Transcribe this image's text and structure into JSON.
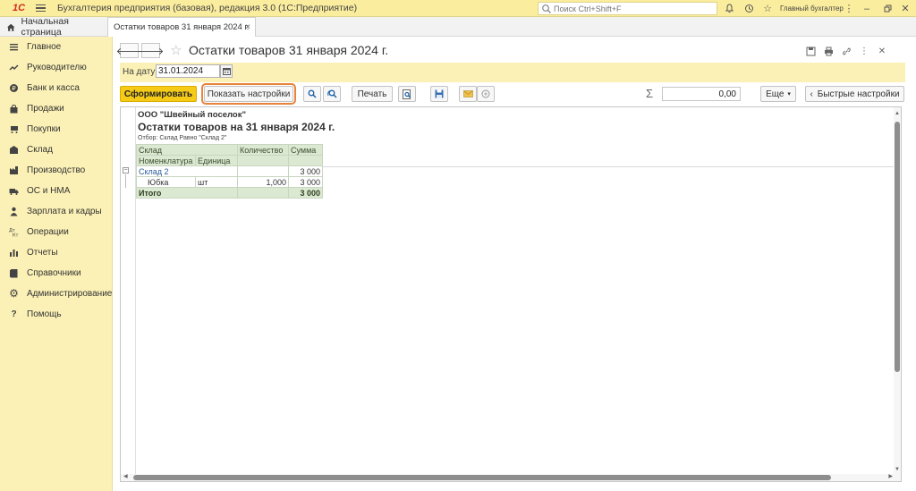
{
  "app": {
    "title": "Бухгалтерия предприятия (базовая), редакция 3.0  (1С:Предприятие)",
    "search_placeholder": "Поиск Ctrl+Shift+F",
    "user": "Главный бухгалтер"
  },
  "tabs": {
    "home": "Начальная страница",
    "active": "Остатки товаров 31 января 2024 г.",
    "close": "×"
  },
  "sidebar": {
    "items": [
      {
        "label": "Главное",
        "icon": "list-icon"
      },
      {
        "label": "Руководителю",
        "icon": "trend-icon"
      },
      {
        "label": "Банк и касса",
        "icon": "coins-icon"
      },
      {
        "label": "Продажи",
        "icon": "bag-icon"
      },
      {
        "label": "Покупки",
        "icon": "cart-icon"
      },
      {
        "label": "Склад",
        "icon": "warehouse-icon"
      },
      {
        "label": "Производство",
        "icon": "factory-icon"
      },
      {
        "label": "ОС и НМА",
        "icon": "truck-icon"
      },
      {
        "label": "Зарплата и кадры",
        "icon": "person-icon"
      },
      {
        "label": "Операции",
        "icon": "operations-icon"
      },
      {
        "label": "Отчеты",
        "icon": "bar-chart-icon"
      },
      {
        "label": "Справочники",
        "icon": "book-icon"
      },
      {
        "label": "Администрирование",
        "icon": "gear-icon"
      },
      {
        "label": "Помощь",
        "icon": "help-icon"
      }
    ]
  },
  "form": {
    "title": "Остатки товаров 31 января 2024 г.",
    "date_label": "На дату:",
    "date_value": "31.01.2024"
  },
  "toolbar": {
    "generate": "Сформировать",
    "show_settings": "Показать настройки",
    "print": "Печать",
    "sum_symbol": "Σ",
    "sum_value": "0,00",
    "more": "Еще",
    "quick_settings": "Быстрые настройки"
  },
  "report": {
    "org": "ООО \"Швейный поселок\"",
    "title": "Остатки товаров на 31 января 2024 г.",
    "filter": "Отбор: Склад Равно \"Склад 2\"",
    "headers": {
      "warehouse": "Склад",
      "item": "Номенклатура",
      "unit": "Единица",
      "quantity": "Количество",
      "sum": "Сумма"
    },
    "group": {
      "label": "Склад 2",
      "sum": "3 000"
    },
    "row": {
      "item": "Юбка",
      "unit": "шт",
      "quantity": "1,000",
      "sum": "3 000"
    },
    "total": {
      "label": "Итого",
      "sum": "3 000"
    }
  },
  "colors": {
    "accent_yellow": "#f5cb17",
    "sidebar_bg": "#fbf1b6",
    "table_header_green": "#dbe8d2",
    "highlight_outline": "#e6843b"
  }
}
